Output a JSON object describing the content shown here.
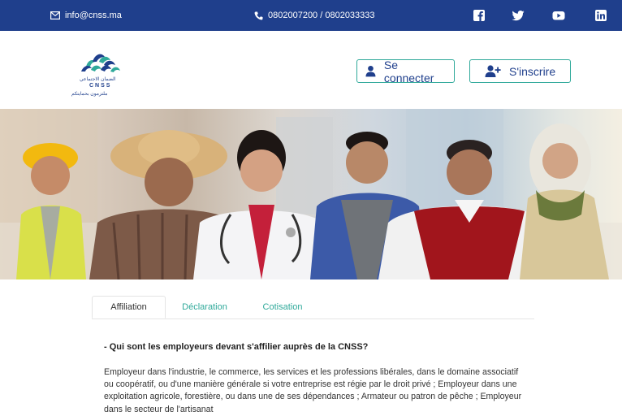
{
  "topbar": {
    "email": "info@cnss.ma",
    "phone": "0802007200 / 0802033333",
    "social": [
      "facebook-icon",
      "twitter-icon",
      "youtube-icon",
      "linkedin-icon"
    ],
    "bg_color": "#1f3f8c"
  },
  "header": {
    "logo": {
      "arabic_line_1": "الضمان الاجتماعي",
      "abbrev": "CNSS",
      "arabic_line_2": "ملتزمون بحمايتكم"
    },
    "login_label": "Se connecter",
    "signup_label": "S'inscrire",
    "accent_color": "#2fa99a"
  },
  "tabs": [
    {
      "label": "Affiliation",
      "active": true
    },
    {
      "label": "Déclaration",
      "active": false
    },
    {
      "label": "Cotisation",
      "active": false
    }
  ],
  "content": {
    "question": "- Qui sont les employeurs devant s'affilier auprès de la CNSS?",
    "paragraph": "Employeur dans l'industrie, le commerce, les services et les professions libérales, dans le domaine associatif ou coopératif, ou d'une manière générale si votre entreprise est régie par le droit privé ; Employeur dans une exploitation agricole, forestière, ou dans une de ses dépendances ; Armateur ou patron de pêche ; Employeur dans le secteur de l'artisanat"
  }
}
